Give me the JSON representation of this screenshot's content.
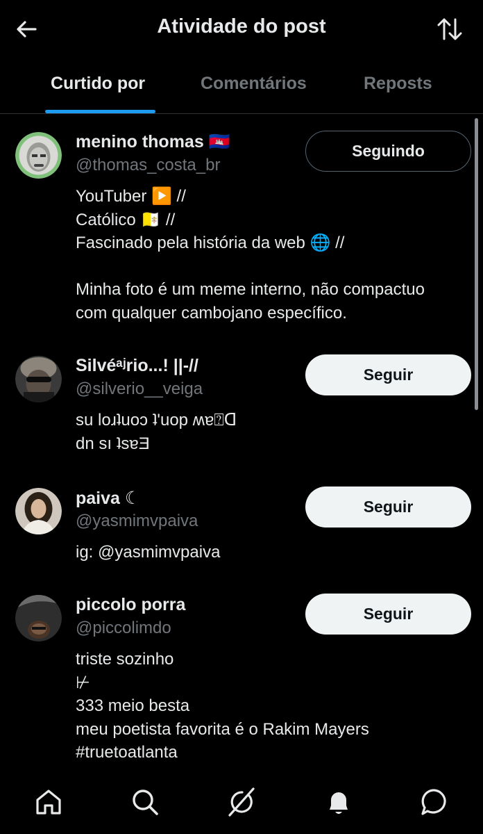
{
  "header": {
    "title": "Atividade do post",
    "back_icon": "arrow-left-icon",
    "sort_icon": "sort-arrows-icon"
  },
  "tabs": [
    {
      "label": "Curtido por",
      "active": true
    },
    {
      "label": "Comentários",
      "active": false
    },
    {
      "label": "Reposts",
      "active": false
    }
  ],
  "users": [
    {
      "name": "menino thomas 🇰🇭",
      "handle": "@thomas_costa_br",
      "button": "Seguindo",
      "bio": [
        "YouTuber ▶️ //",
        "Católico 🇻🇦 //",
        "Fascinado pela história da web 🌐 //",
        "",
        "Minha foto é um meme interno, não compactuo",
        "com qualquer cambojano específico."
      ]
    },
    {
      "name": "Silvéᵃʲrio...! ||-//",
      "handle": "@silverio__veiga",
      "button": "Seguir",
      "bio": [
        "su loɹʇuoɔ ʇ'uop ʍɐ⍰ᗡ",
        "dn sı ʇsɐƎ"
      ]
    },
    {
      "name": "paiva ☾",
      "handle": "@yasmimvpaiva",
      "button": "Seguir",
      "bio": [
        "ig: @yasmimvpaiva"
      ]
    },
    {
      "name": "piccolo porra",
      "handle": "@piccolimdo",
      "button": "Seguir",
      "bio": [
        "triste sozinho",
        "⊬",
        "333 meio besta",
        "meu poetista favorita é o Rakim Mayers",
        "#truetoatlanta"
      ]
    }
  ],
  "bottom_nav": [
    {
      "icon": "home-icon"
    },
    {
      "icon": "search-icon"
    },
    {
      "icon": "grok-icon"
    },
    {
      "icon": "bell-icon"
    },
    {
      "icon": "chat-bubble-icon"
    }
  ]
}
